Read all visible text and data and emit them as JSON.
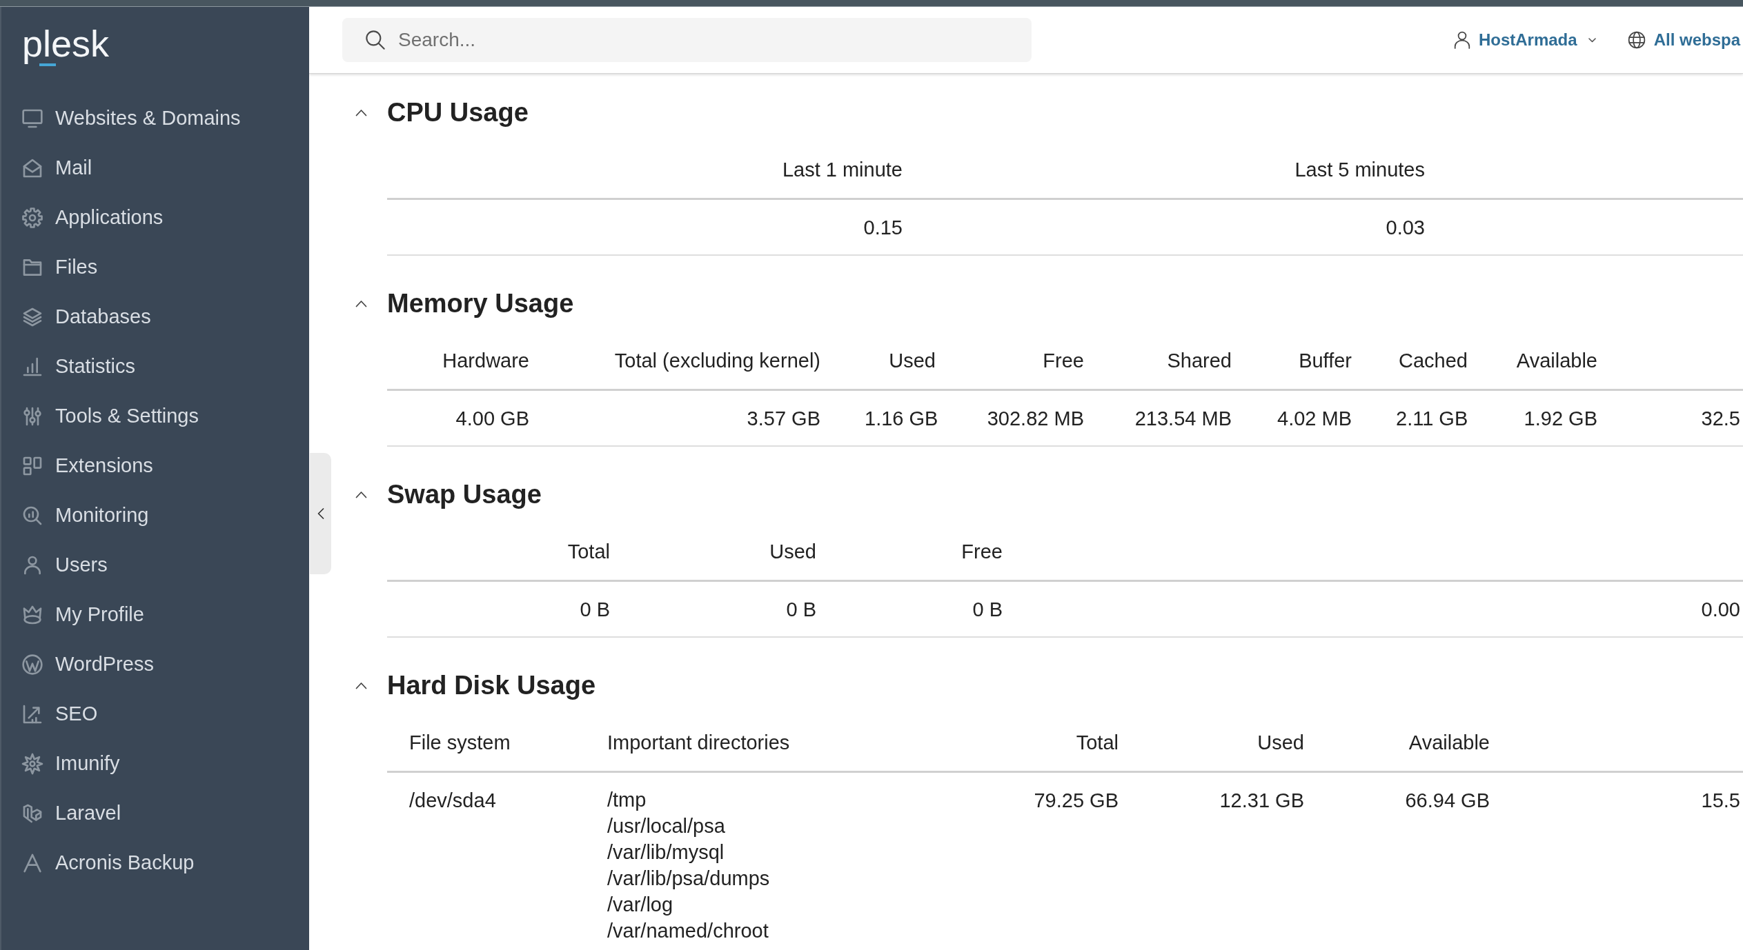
{
  "sidebar": {
    "logo": "plesk",
    "items": [
      {
        "label": "Websites & Domains"
      },
      {
        "label": "Mail"
      },
      {
        "label": "Applications"
      },
      {
        "label": "Files"
      },
      {
        "label": "Databases"
      },
      {
        "label": "Statistics"
      },
      {
        "label": "Tools & Settings"
      },
      {
        "label": "Extensions"
      },
      {
        "label": "Monitoring"
      },
      {
        "label": "Users"
      },
      {
        "label": "My Profile"
      },
      {
        "label": "WordPress"
      },
      {
        "label": "SEO"
      },
      {
        "label": "Imunify"
      },
      {
        "label": "Laravel"
      },
      {
        "label": "Acronis Backup"
      }
    ]
  },
  "top_bar": {
    "search": {
      "placeholder": "Search..."
    },
    "account_menu": {
      "label": "HostArmada"
    },
    "webspace_menu": {
      "label": "All webspa"
    }
  },
  "sections": [
    {
      "title": "CPU Usage",
      "expanded": true,
      "table": {
        "columns": [
          "Last 1 minute",
          "Last 5 minutes"
        ],
        "rows": [
          {
            "cells": [
              "0.15",
              "0.03"
            ]
          }
        ]
      }
    },
    {
      "title": "Memory Usage",
      "expanded": true,
      "table": {
        "columns": [
          "Hardware",
          "Total (excluding kernel)",
          "Used",
          "Free",
          "Shared",
          "Buffer",
          "Cached",
          "Available"
        ],
        "rows": [
          {
            "cells": [
              "4.00 GB",
              "3.57 GB",
              "1.16 GB",
              "302.82 MB",
              "213.54 MB",
              "4.02 MB",
              "2.11 GB",
              "1.92 GB",
              "32.5"
            ]
          }
        ]
      }
    },
    {
      "title": "Swap Usage",
      "expanded": true,
      "table": {
        "columns": [
          "Total",
          "Used",
          "Free"
        ],
        "rows": [
          {
            "cells": [
              "0 B",
              "0 B",
              "0 B",
              "0.00"
            ]
          }
        ]
      }
    },
    {
      "title": "Hard Disk Usage",
      "expanded": true,
      "table": {
        "columns": [
          "File system",
          "Important directories",
          "Total",
          "Used",
          "Available"
        ],
        "rows": [
          {
            "cells": [
              "/dev/sda4",
              [
                "/tmp",
                "/usr/local/psa",
                "/var/lib/mysql",
                "/var/lib/psa/dumps",
                "/var/log",
                "/var/named/chroot"
              ],
              "79.25 GB",
              "12.31 GB",
              "66.94 GB",
              "15.5"
            ]
          }
        ]
      }
    }
  ]
}
